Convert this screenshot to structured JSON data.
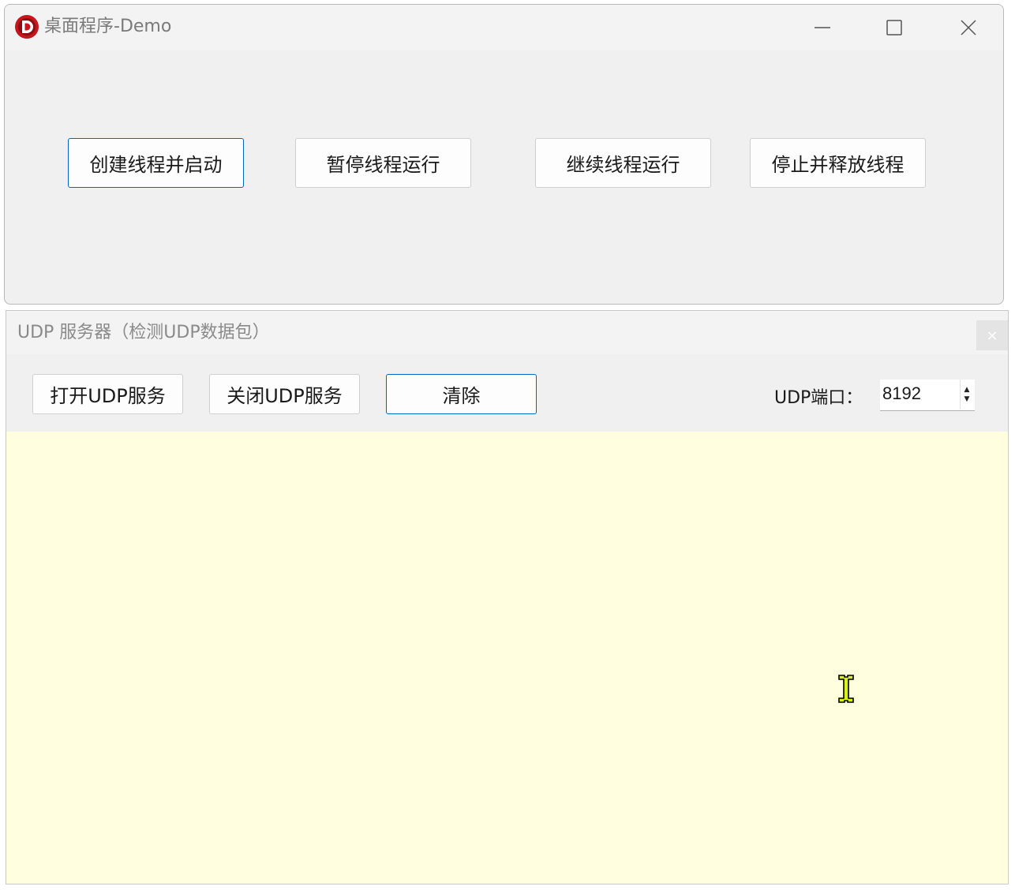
{
  "window": {
    "title": "桌面程序-Demo",
    "icon": "app-logo-D-icon",
    "controls": {
      "minimize": "minimize-icon",
      "maximize": "maximize-icon",
      "close": "close-icon"
    }
  },
  "thread_controls": {
    "create_start_label": "创建线程并启动",
    "pause_label": "暂停线程运行",
    "resume_label": "继续线程运行",
    "stop_release_label": "停止并释放线程"
  },
  "udp_panel": {
    "title": "UDP 服务器（检测UDP数据包）",
    "close_glyph": "×",
    "open_label": "打开UDP服务",
    "close_label": "关闭UDP服务",
    "clear_label": "清除",
    "port_label": "UDP端口：",
    "port_value": "8192",
    "log_text": ""
  },
  "colors": {
    "accent": "#0067c0",
    "log_background": "#ffffe0",
    "window_background": "#f0f0f0"
  }
}
